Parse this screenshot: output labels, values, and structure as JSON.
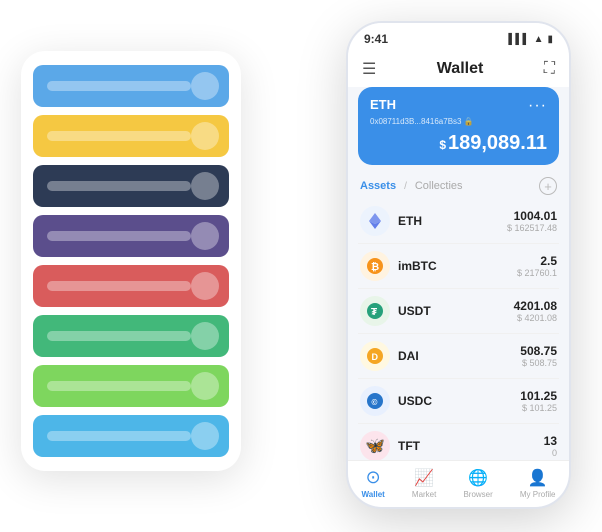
{
  "status": {
    "time": "9:41",
    "signal": "●●●",
    "wifi": "WiFi",
    "battery": "🔋"
  },
  "header": {
    "title": "Wallet",
    "menu_icon": "☰",
    "scan_icon": "⛶"
  },
  "eth_card": {
    "ticker": "ETH",
    "address": "0x08711d3B...8416a7Bs3",
    "emoji": "🔒",
    "dots": "···",
    "currency_prefix": "$",
    "balance": "189,089.11"
  },
  "assets_section": {
    "tab_active": "Assets",
    "tab_separator": "/",
    "tab_inactive": "Collecties",
    "add_icon": "+"
  },
  "assets": [
    {
      "symbol": "ETH",
      "icon_char": "◈",
      "icon_class": "icon-eth",
      "amount": "1004.01",
      "usd": "$ 162517.48"
    },
    {
      "symbol": "imBTC",
      "icon_char": "⊙",
      "icon_class": "icon-imbtc",
      "amount": "2.5",
      "usd": "$ 21760.1"
    },
    {
      "symbol": "USDT",
      "icon_char": "₮",
      "icon_class": "icon-usdt",
      "amount": "4201.08",
      "usd": "$ 4201.08"
    },
    {
      "symbol": "DAI",
      "icon_char": "◎",
      "icon_class": "icon-dai",
      "amount": "508.75",
      "usd": "$ 508.75"
    },
    {
      "symbol": "USDC",
      "icon_char": "©",
      "icon_class": "icon-usdc",
      "amount": "101.25",
      "usd": "$ 101.25"
    },
    {
      "symbol": "TFT",
      "icon_char": "🦋",
      "icon_class": "icon-tft",
      "amount": "13",
      "usd": "0"
    }
  ],
  "bottom_nav": [
    {
      "label": "Wallet",
      "icon": "⊙",
      "active": true
    },
    {
      "label": "Market",
      "icon": "📊",
      "active": false
    },
    {
      "label": "Browser",
      "icon": "👤",
      "active": false
    },
    {
      "label": "My Profile",
      "icon": "👤",
      "active": false
    }
  ],
  "card_rows": [
    {
      "color_class": "row-blue"
    },
    {
      "color_class": "row-yellow"
    },
    {
      "color_class": "row-dark"
    },
    {
      "color_class": "row-purple"
    },
    {
      "color_class": "row-red"
    },
    {
      "color_class": "row-green"
    },
    {
      "color_class": "row-light-green"
    },
    {
      "color_class": "row-sky"
    }
  ]
}
